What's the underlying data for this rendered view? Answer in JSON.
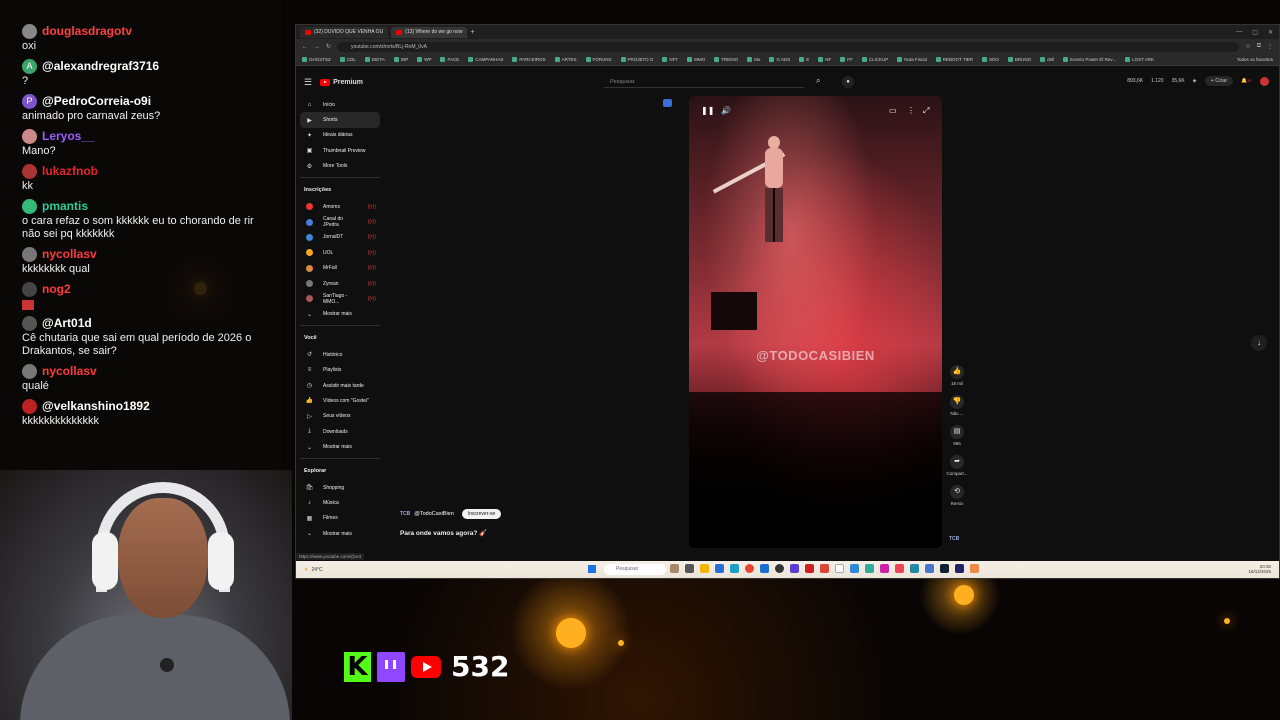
{
  "chat": {
    "messages": [
      {
        "user": "douglasdragotv",
        "color": "#ff4040",
        "avatar": "#888",
        "text": "oxi"
      },
      {
        "user": "@alexandregraf3716",
        "color": "#ffffff",
        "avatar": "#3aa46b",
        "avatar_letter": "A",
        "text": "?"
      },
      {
        "user": "@PedroCorreia-o9i",
        "color": "#ffffff",
        "avatar": "#7b54c9",
        "avatar_letter": "P",
        "text": "animado pro carnaval zeus?"
      },
      {
        "user": "Leryos__",
        "color": "#9b5cff",
        "avatar": "#c88",
        "text": "Mano?"
      },
      {
        "user": "lukazfnob",
        "color": "#e0262e",
        "avatar": "#a33",
        "text": "kk"
      },
      {
        "user": "pmantis",
        "color": "#2ecc9a",
        "avatar": "#3b7",
        "text": "o cara refaz o som kkkkkk eu to chorando de rir não sei pq kkkkkkk"
      },
      {
        "user": "nycollasv",
        "color": "#ff3a3a",
        "avatar": "#777",
        "text": "kkkkkkkk qual"
      },
      {
        "user": "nog2",
        "color": "#ff3a3a",
        "avatar": "#444",
        "text": ""
      },
      {
        "user": "@Art01d",
        "color": "#ffffff",
        "avatar": "#555",
        "text": "Cê chutaria que sai em qual período de 2026 o Drakantos, se sair?"
      },
      {
        "user": "nycollasv",
        "color": "#ff3a3a",
        "avatar": "#777",
        "text": "qualé"
      },
      {
        "user": "@velkanshino1892",
        "color": "#ffffff",
        "avatar": "#b22",
        "text": "kkkkkkkkkkkkkk"
      }
    ]
  },
  "browser": {
    "tabs": [
      {
        "label": "(32) DUVIDO QUE VENHA OU"
      },
      {
        "label": "(13) Where do we go now"
      }
    ],
    "url": "youtube.com/shorts/BLj-RoM_0vA",
    "bookmarks": [
      "GHOSTSZ",
      "CDL",
      "DIETA",
      "INP",
      "WP",
      "FACE",
      "CAMPANHAS",
      "PARCEIROS",
      "ARTES",
      "FÓRUNS",
      "PROJETO G",
      "NFT",
      "MMO",
      "TREINO",
      "Mu",
      "G ADS",
      "E",
      "NF",
      "FF",
      "CLICKUP",
      "Nota Fiscal",
      "REBOOT TIER",
      "SDO",
      "BRUNO",
      "dell",
      "Evento Power El Rev...",
      "LOST ARK"
    ],
    "bookmarks_right": "Todos os favoritos"
  },
  "youtube": {
    "brand": "Premium",
    "search_placeholder": "Pesquisar",
    "stats": [
      "893,6K",
      "1.120",
      "35,6K"
    ],
    "create_label": "Criar",
    "notif_count": "9+",
    "sidebar": {
      "main": [
        {
          "label": "Início",
          "icon": "home-icon"
        },
        {
          "label": "Shorts",
          "icon": "shorts-icon",
          "selected": true
        },
        {
          "label": "Ideais diárias",
          "icon": "ideas-icon"
        },
        {
          "label": "Thumbnail Preview",
          "icon": "thumbnail-icon"
        },
        {
          "label": "More Tools",
          "icon": "tools-icon"
        }
      ],
      "subs_header": "Inscrições",
      "subs": [
        {
          "label": "Amoms",
          "color": "#e33"
        },
        {
          "label": "Canal do JPedra",
          "color": "#4a7bd8"
        },
        {
          "label": "JornalDT",
          "color": "#3a8ad8"
        },
        {
          "label": "UOL",
          "color": "#f5a623"
        },
        {
          "label": "MrFall",
          "color": "#d84"
        },
        {
          "label": "Zyrean",
          "color": "#777"
        },
        {
          "label": "SanTiago - MMO...",
          "color": "#a55"
        }
      ],
      "more_label": "Mostrar mais",
      "you_header": "Você",
      "you": [
        {
          "label": "Histórico",
          "icon": "history-icon"
        },
        {
          "label": "Playlists",
          "icon": "playlist-icon"
        },
        {
          "label": "Assistir mais tarde",
          "icon": "clock-icon"
        },
        {
          "label": "Vídeos com \"Gostei\"",
          "icon": "like-icon"
        },
        {
          "label": "Seus vídeos",
          "icon": "video-icon"
        },
        {
          "label": "Downloads",
          "icon": "download-icon"
        }
      ],
      "explore_header": "Explorar",
      "explore": [
        {
          "label": "Shopping",
          "icon": "bag-icon"
        },
        {
          "label": "Música",
          "icon": "music-icon"
        },
        {
          "label": "Filmes",
          "icon": "film-icon"
        }
      ]
    },
    "short": {
      "watermark": "@TODOCASIBIEN",
      "channel_logo": "TCB",
      "channel": "@TodoCasiBien",
      "subscribe_label": "Inscrever-se",
      "title": "Para onde vamos agora? 🎸",
      "actions": [
        {
          "icon": "thumbs-up-icon",
          "label": "18 mil"
        },
        {
          "icon": "thumbs-down-icon",
          "label": "Não ..."
        },
        {
          "icon": "comment-icon",
          "label": "986"
        },
        {
          "icon": "share-icon",
          "label": "Compart..."
        },
        {
          "icon": "remix-icon",
          "label": "Remix"
        }
      ]
    },
    "hover_url": "https://www.youtube.com/@unt"
  },
  "taskbar": {
    "weather": "24°C",
    "search_placeholder": "Pesquisar",
    "time": "20:36",
    "date": "16/12/2025"
  },
  "overlay": {
    "viewer_count": "532"
  }
}
